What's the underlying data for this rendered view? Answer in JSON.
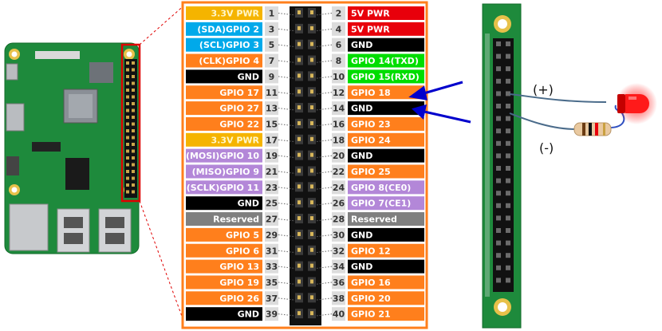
{
  "colors": {
    "power_yellow": "#f5b400",
    "power_red": "#e8000b",
    "ground": "#000000",
    "i2c_blue": "#00a9ea",
    "uart_green": "#00dd00",
    "gpio_orange": "#ff7f1c",
    "spi_purple": "#b387d8",
    "reserved_gray": "#7f7f7f",
    "board_green": "#1e8a3c",
    "frame_orange": "#ff7f1c"
  },
  "left_pins": [
    {
      "label": "3.3V PWR",
      "num": "1",
      "kind": "power_yellow"
    },
    {
      "label": "(SDA)GPIO 2",
      "num": "3",
      "kind": "i2c_blue"
    },
    {
      "label": "(SCL)GPIO 3",
      "num": "5",
      "kind": "i2c_blue"
    },
    {
      "label": "(CLK)GPIO 4",
      "num": "7",
      "kind": "gpio_orange"
    },
    {
      "label": "GND",
      "num": "9",
      "kind": "ground"
    },
    {
      "label": "GPIO 17",
      "num": "11",
      "kind": "gpio_orange"
    },
    {
      "label": "GPIO 27",
      "num": "13",
      "kind": "gpio_orange"
    },
    {
      "label": "GPIO 22",
      "num": "15",
      "kind": "gpio_orange"
    },
    {
      "label": "3.3V PWR",
      "num": "17",
      "kind": "power_yellow"
    },
    {
      "label": "(MOSI)GPIO 10",
      "num": "19",
      "kind": "spi_purple"
    },
    {
      "label": "(MISO)GPIO 9",
      "num": "21",
      "kind": "spi_purple"
    },
    {
      "label": "(SCLK)GPIO 11",
      "num": "23",
      "kind": "spi_purple"
    },
    {
      "label": "GND",
      "num": "25",
      "kind": "ground"
    },
    {
      "label": "Reserved",
      "num": "27",
      "kind": "reserved_gray"
    },
    {
      "label": "GPIO 5",
      "num": "29",
      "kind": "gpio_orange"
    },
    {
      "label": "GPIO 6",
      "num": "31",
      "kind": "gpio_orange"
    },
    {
      "label": "GPIO 13",
      "num": "33",
      "kind": "gpio_orange"
    },
    {
      "label": "GPIO 19",
      "num": "35",
      "kind": "gpio_orange"
    },
    {
      "label": "GPIO 26",
      "num": "37",
      "kind": "gpio_orange"
    },
    {
      "label": "GND",
      "num": "39",
      "kind": "ground"
    }
  ],
  "right_pins": [
    {
      "label": "5V PWR",
      "num": "2",
      "kind": "power_red"
    },
    {
      "label": "5V PWR",
      "num": "4",
      "kind": "power_red"
    },
    {
      "label": "GND",
      "num": "6",
      "kind": "ground"
    },
    {
      "label": "GPIO 14(TXD)",
      "num": "8",
      "kind": "uart_green"
    },
    {
      "label": "GPIO 15(RXD)",
      "num": "10",
      "kind": "uart_green"
    },
    {
      "label": "GPIO 18",
      "num": "12",
      "kind": "gpio_orange"
    },
    {
      "label": "GND",
      "num": "14",
      "kind": "ground"
    },
    {
      "label": "GPIO 23",
      "num": "16",
      "kind": "gpio_orange"
    },
    {
      "label": "GPIO 24",
      "num": "18",
      "kind": "gpio_orange"
    },
    {
      "label": "GND",
      "num": "20",
      "kind": "ground"
    },
    {
      "label": "GPIO 25",
      "num": "22",
      "kind": "gpio_orange"
    },
    {
      "label": "GPIO 8(CE0)",
      "num": "24",
      "kind": "spi_purple"
    },
    {
      "label": "GPIO 7(CE1)",
      "num": "26",
      "kind": "spi_purple"
    },
    {
      "label": "Reserved",
      "num": "28",
      "kind": "reserved_gray"
    },
    {
      "label": "GND",
      "num": "30",
      "kind": "ground"
    },
    {
      "label": "GPIO 12",
      "num": "32",
      "kind": "gpio_orange"
    },
    {
      "label": "GND",
      "num": "34",
      "kind": "ground"
    },
    {
      "label": "GPIO 16",
      "num": "36",
      "kind": "gpio_orange"
    },
    {
      "label": "GPIO 20",
      "num": "38",
      "kind": "gpio_orange"
    },
    {
      "label": "GPIO 21",
      "num": "40",
      "kind": "gpio_orange"
    }
  ],
  "circuit": {
    "plus_label": "(+)",
    "minus_label": "(-)",
    "led_color": "#e8000b",
    "arrow_color": "#0000cc",
    "wire_color": "#4a6b8a"
  },
  "icons": [
    "raspberry-pi-board-photo",
    "header-closeup",
    "led-icon",
    "resistor-icon",
    "arrow-icon"
  ]
}
